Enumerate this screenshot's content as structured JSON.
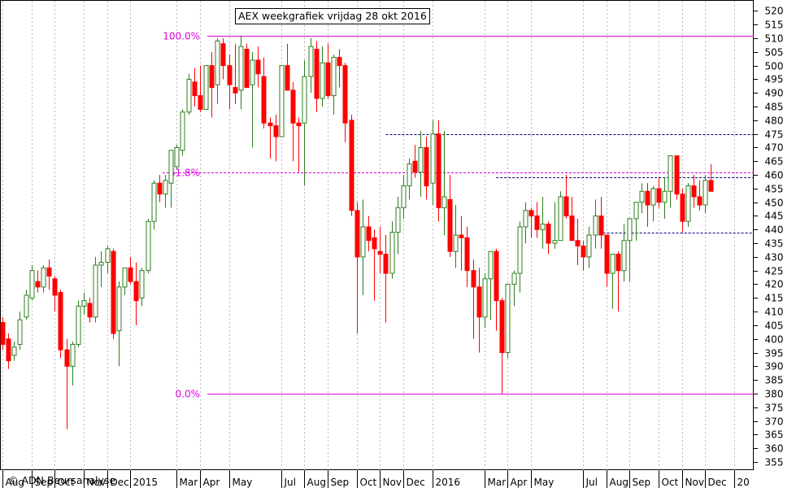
{
  "chart_data": {
    "type": "candlestick",
    "title": "AEX weekgrafiek vrijdag 28 okt 2016",
    "copyright": "© ADN Beursanalyse",
    "ylim": [
      352,
      524
    ],
    "y_ticks": [
      355,
      360,
      365,
      370,
      375,
      380,
      385,
      390,
      395,
      400,
      405,
      410,
      415,
      420,
      425,
      430,
      435,
      440,
      445,
      450,
      455,
      460,
      465,
      470,
      475,
      480,
      485,
      490,
      495,
      500,
      505,
      510,
      515,
      520
    ],
    "x_ticks": [
      {
        "label": "Aug",
        "week": 0
      },
      {
        "label": "Sep",
        "week": 5
      },
      {
        "label": "Oct",
        "week": 9
      },
      {
        "label": "Nov",
        "week": 14
      },
      {
        "label": "Dec",
        "week": 18
      },
      {
        "label": "2015",
        "week": 22
      },
      {
        "label": "Mar",
        "week": 30
      },
      {
        "label": "Apr",
        "week": 34
      },
      {
        "label": "May",
        "week": 39
      },
      {
        "label": "Jul",
        "week": 48
      },
      {
        "label": "Aug",
        "week": 52
      },
      {
        "label": "Sep",
        "week": 56
      },
      {
        "label": "Oct",
        "week": 61
      },
      {
        "label": "Nov",
        "week": 65
      },
      {
        "label": "Dec",
        "week": 69
      },
      {
        "label": "2016",
        "week": 74
      },
      {
        "label": "Mar",
        "week": 83
      },
      {
        "label": "Apr",
        "week": 87
      },
      {
        "label": "May",
        "week": 91
      },
      {
        "label": "Jul",
        "week": 100
      },
      {
        "label": "Aug",
        "week": 104
      },
      {
        "label": "Sep",
        "week": 108
      },
      {
        "label": "Oct",
        "week": 113
      },
      {
        "label": "Nov",
        "week": 117
      },
      {
        "label": "Dec",
        "week": 121
      },
      {
        "label": "20",
        "week": 126
      }
    ],
    "fib_levels": [
      {
        "label": "100.0%",
        "value": 511
      },
      {
        "label": "61.8%",
        "value": 461
      },
      {
        "label": "0.0%",
        "value": 380
      }
    ],
    "dashed_lines": [
      {
        "value": 475,
        "from_week": 66,
        "to_week": 126
      },
      {
        "value": 459,
        "from_week": 85,
        "to_week": 126
      },
      {
        "value": 439,
        "from_week": 102,
        "to_week": 126
      }
    ],
    "colors": {
      "up": "#2e7d1e",
      "down": "#ff0000",
      "fib": "#dd00dd",
      "dashed": "#00008b",
      "grid": "#bbbbbb",
      "green_fill": "#009900"
    },
    "candles": [
      [
        406,
        408,
        396,
        398
      ],
      [
        400,
        402,
        389,
        392
      ],
      [
        394,
        399,
        392,
        397
      ],
      [
        398,
        410,
        396,
        407
      ],
      [
        408,
        418,
        407,
        416
      ],
      [
        415,
        427,
        414,
        425
      ],
      [
        421,
        425,
        417,
        419
      ],
      [
        419,
        427,
        417,
        426
      ],
      [
        426,
        429,
        418,
        423
      ],
      [
        422,
        423,
        410,
        416
      ],
      [
        417,
        418,
        393,
        396
      ],
      [
        396,
        400,
        367,
        390
      ],
      [
        390,
        399,
        383,
        398
      ],
      [
        398,
        414,
        397,
        412
      ],
      [
        412,
        417,
        409,
        414
      ],
      [
        413,
        415,
        406,
        408
      ],
      [
        408,
        430,
        406,
        427
      ],
      [
        427,
        432,
        419,
        428
      ],
      [
        428,
        434,
        424,
        433
      ],
      [
        432,
        433,
        400,
        402
      ],
      [
        403,
        421,
        390,
        419
      ],
      [
        419,
        426,
        416,
        426
      ],
      [
        426,
        430,
        420,
        421
      ],
      [
        421,
        428,
        405,
        414
      ],
      [
        415,
        426,
        412,
        425
      ],
      [
        425,
        444,
        424,
        443
      ],
      [
        443,
        458,
        440,
        457
      ],
      [
        457,
        460,
        450,
        453
      ],
      [
        453,
        460,
        448,
        458
      ],
      [
        457,
        468,
        448,
        469
      ],
      [
        463,
        471,
        462,
        470
      ],
      [
        469,
        484,
        467,
        483
      ],
      [
        483,
        497,
        482,
        495
      ],
      [
        494,
        499,
        485,
        489
      ],
      [
        489,
        500,
        483,
        484
      ],
      [
        484,
        500,
        484,
        500
      ],
      [
        500,
        505,
        481,
        492
      ],
      [
        493,
        510,
        486,
        509
      ],
      [
        508,
        510,
        495,
        500
      ],
      [
        500,
        504,
        484,
        493
      ],
      [
        492,
        508,
        486,
        490
      ],
      [
        491,
        511,
        484,
        507
      ],
      [
        506,
        508,
        492,
        492
      ],
      [
        493,
        505,
        470,
        502
      ],
      [
        502,
        507,
        492,
        497
      ],
      [
        496,
        503,
        477,
        479
      ],
      [
        479,
        481,
        466,
        478
      ],
      [
        478,
        482,
        465,
        474
      ],
      [
        474,
        500,
        474,
        500
      ],
      [
        500,
        508,
        492,
        491
      ],
      [
        491,
        494,
        465,
        479
      ],
      [
        479,
        481,
        461,
        478
      ],
      [
        479,
        502,
        456,
        496
      ],
      [
        496,
        510,
        490,
        507
      ],
      [
        506,
        509,
        483,
        488
      ],
      [
        488,
        507,
        485,
        501
      ],
      [
        501,
        508,
        488,
        489
      ],
      [
        489,
        504,
        482,
        503
      ],
      [
        503,
        506,
        492,
        500
      ],
      [
        500,
        501,
        472,
        479
      ],
      [
        480,
        482,
        445,
        447
      ],
      [
        447,
        450,
        402,
        430
      ],
      [
        430,
        451,
        416,
        441
      ],
      [
        441,
        445,
        432,
        436
      ],
      [
        437,
        440,
        414,
        433
      ],
      [
        432,
        441,
        424,
        431
      ],
      [
        431,
        438,
        406,
        424
      ],
      [
        424,
        443,
        422,
        439
      ],
      [
        439,
        452,
        431,
        448
      ],
      [
        448,
        460,
        444,
        456
      ],
      [
        456,
        466,
        451,
        464
      ],
      [
        465,
        471,
        459,
        461
      ],
      [
        461,
        476,
        452,
        470
      ],
      [
        470,
        474,
        451,
        456
      ],
      [
        457,
        480,
        449,
        475
      ],
      [
        475,
        480,
        443,
        448
      ],
      [
        448,
        476,
        438,
        452
      ],
      [
        451,
        460,
        430,
        432
      ],
      [
        432,
        449,
        426,
        438
      ],
      [
        438,
        445,
        425,
        437
      ],
      [
        437,
        441,
        419,
        425
      ],
      [
        425,
        429,
        400,
        419
      ],
      [
        419,
        426,
        395,
        408
      ],
      [
        408,
        424,
        404,
        422
      ],
      [
        422,
        431,
        407,
        432
      ],
      [
        432,
        433,
        403,
        414
      ],
      [
        414,
        415,
        380,
        395
      ],
      [
        395,
        418,
        393,
        420
      ],
      [
        420,
        425,
        412,
        424
      ],
      [
        424,
        443,
        417,
        441
      ],
      [
        441,
        450,
        435,
        447
      ],
      [
        447,
        448,
        437,
        445
      ],
      [
        445,
        450,
        437,
        440
      ],
      [
        440,
        452,
        433,
        442
      ],
      [
        442,
        443,
        431,
        435
      ],
      [
        435,
        450,
        433,
        436
      ],
      [
        436,
        454,
        438,
        452
      ],
      [
        452,
        460,
        444,
        445
      ],
      [
        445,
        452,
        436,
        436
      ],
      [
        436,
        444,
        427,
        434
      ],
      [
        434,
        436,
        425,
        430
      ],
      [
        430,
        441,
        426,
        438
      ],
      [
        438,
        451,
        433,
        445
      ],
      [
        445,
        452,
        433,
        438
      ],
      [
        438,
        437,
        419,
        424
      ],
      [
        424,
        427,
        411,
        431
      ],
      [
        431,
        432,
        410,
        425
      ],
      [
        425,
        442,
        421,
        436
      ],
      [
        436,
        442,
        421,
        444
      ],
      [
        444,
        449,
        436,
        450
      ],
      [
        450,
        457,
        446,
        454
      ],
      [
        454,
        457,
        441,
        449
      ],
      [
        449,
        456,
        443,
        455
      ],
      [
        455,
        459,
        448,
        450
      ],
      [
        450,
        459,
        444,
        454
      ],
      [
        454,
        461,
        448,
        467
      ],
      [
        467,
        467,
        451,
        453
      ],
      [
        453,
        455,
        439,
        443
      ],
      [
        443,
        457,
        441,
        456
      ],
      [
        456,
        460,
        448,
        452
      ],
      [
        452,
        458,
        447,
        449
      ],
      [
        449,
        460,
        446,
        458
      ],
      [
        458,
        464,
        454,
        454
      ]
    ]
  }
}
